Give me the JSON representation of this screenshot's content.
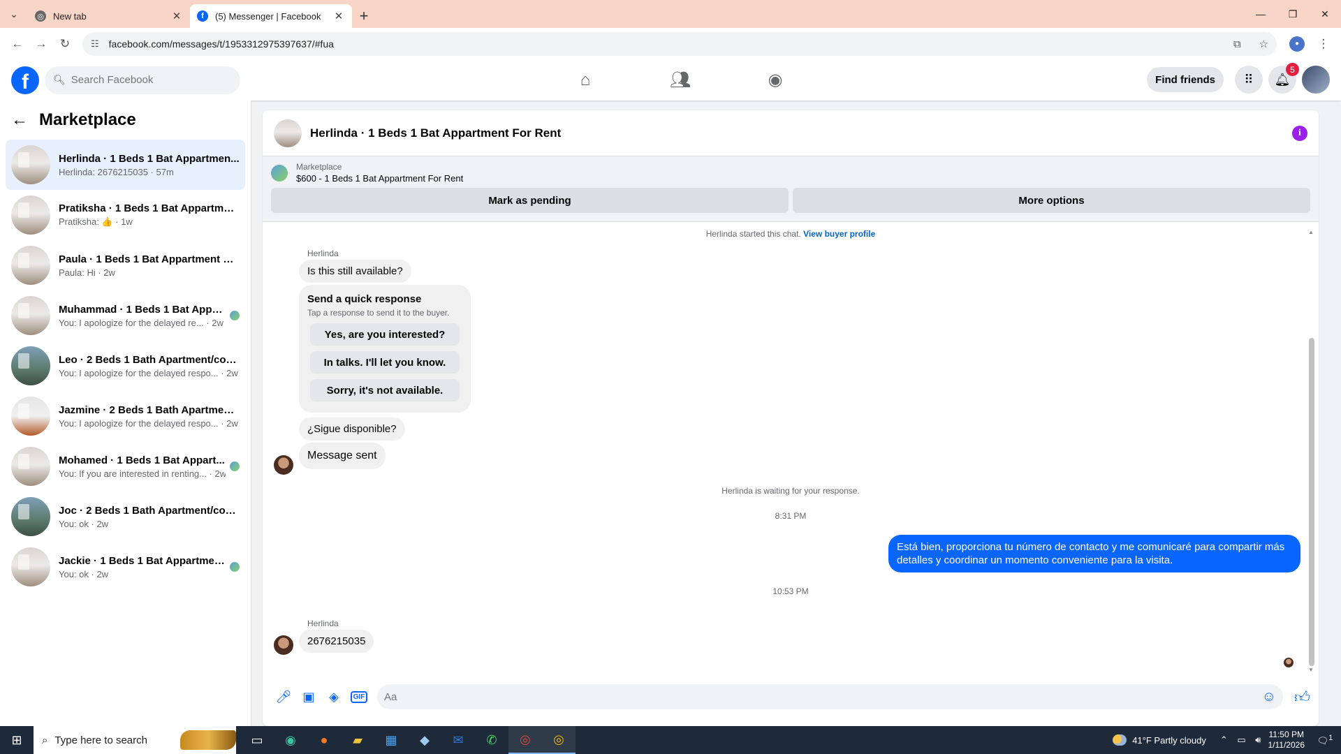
{
  "browser": {
    "tabs": [
      {
        "title": "New tab",
        "active": false
      },
      {
        "title": "(5) Messenger | Facebook",
        "active": true
      }
    ],
    "url": "facebook.com/messages/t/1953312975397637/#fua"
  },
  "fb": {
    "search_placeholder": "Search Facebook",
    "find_friends": "Find friends",
    "notification_count": "5",
    "brand_color": "#0866ff"
  },
  "sidebar": {
    "title": "Marketplace",
    "conversations": [
      {
        "name": "Herlinda · 1 Beds 1 Bat Appartmen...",
        "preview": "Herlinda: 2676215035 · 57m",
        "active": true
      },
      {
        "name": "Pratiksha · 1 Beds 1 Bat Appartmen...",
        "preview": "Pratiksha: 👍 · 1w"
      },
      {
        "name": "Paula · 1 Beds 1 Bat Appartment Fo...",
        "preview": "Paula: Hi · 2w"
      },
      {
        "name": "Muhammad · 1 Beds 1 Bat Appar...",
        "preview": "You: I apologize for the delayed re... · 2w"
      },
      {
        "name": "Leo · 2 Beds 1 Bath Apartment/con...",
        "preview": "You: I apologize for the delayed respo... · 2w"
      },
      {
        "name": "Jazmine · 2 Beds 1 Bath Apartment...",
        "preview": "You: I apologize for the delayed respo... · 2w"
      },
      {
        "name": "Mohamed · 1 Beds 1 Bat Appart...",
        "preview": "You: If you are interested in renting... · 2w"
      },
      {
        "name": "Joc · 2 Beds 1 Bath Apartment/con...",
        "preview": "You: ok · 2w"
      },
      {
        "name": "Jackie · 1 Beds 1 Bat Appartment...",
        "preview": "You: ok · 2w"
      }
    ]
  },
  "chat": {
    "title": "Herlinda · 1 Beds 1 Bat Appartment For Rent",
    "listing_category": "Marketplace",
    "listing_price": "$600 - 1 Beds 1 Bat Appartment For Rent",
    "mark_pending": "Mark as pending",
    "more_options": "More options",
    "started_text": "Herlinda started this chat.",
    "view_profile": "View buyer profile",
    "sender_name": "Herlinda",
    "msg1": "Is this still available?",
    "quick_title": "Send a quick response",
    "quick_sub": "Tap a response to send it to the buyer.",
    "quick_opts": [
      "Yes, are you interested?",
      "In talks. I'll let you know.",
      "Sorry, it's not available."
    ],
    "msg2": "¿Sigue disponible?",
    "msg3": "Message sent",
    "waiting": "Herlinda is waiting for your response.",
    "time1": "8:31 PM",
    "outgoing": "Está bien, proporciona tu número de contacto y me comunicaré para compartir más detalles y coordinar un momento conveniente para la visita.",
    "time2": "10:53 PM",
    "msg4": "2676215035",
    "composer_placeholder": "Aa"
  },
  "taskbar": {
    "search_placeholder": "Type here to search",
    "weather": "41°F  Partly cloudy",
    "time": "11:50 PM",
    "date": "1/11/2026",
    "notif_count": "1"
  }
}
